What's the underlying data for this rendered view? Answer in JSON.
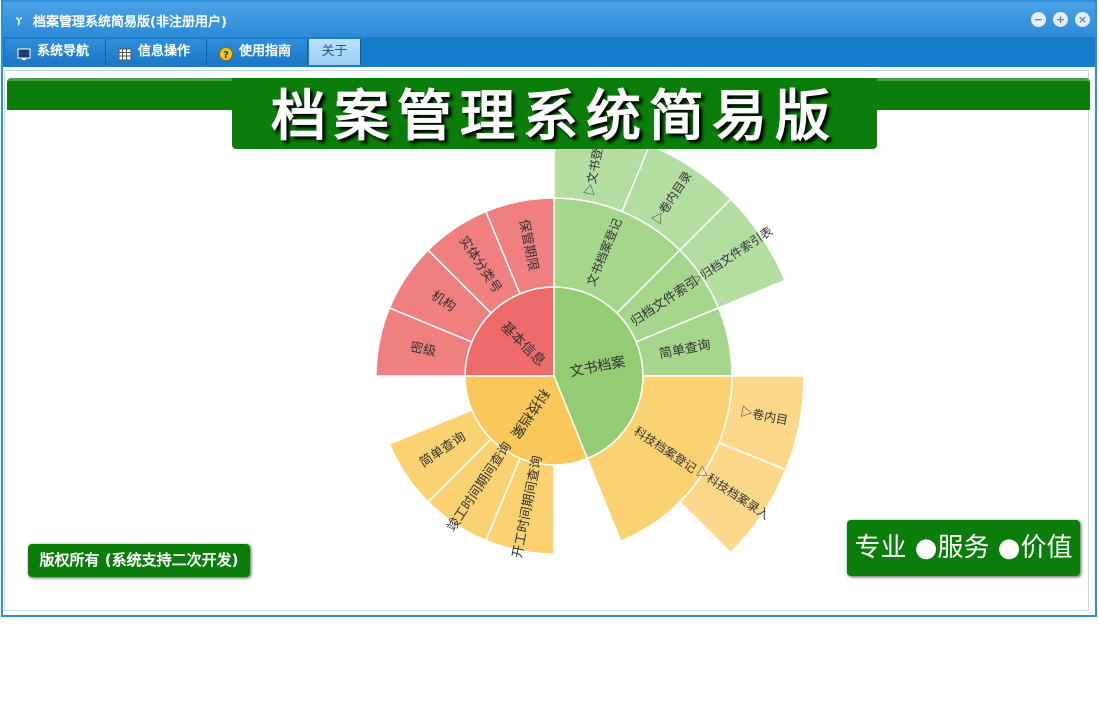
{
  "window": {
    "title": "档案管理系统简易版(非注册用户)",
    "app_icon": "yf-logo-icon"
  },
  "controls": {
    "minimize": "−",
    "restore": "+",
    "close": "×"
  },
  "menu": [
    {
      "label": "系统导航",
      "icon": "monitor-icon"
    },
    {
      "label": "信息操作",
      "icon": "grid-icon"
    },
    {
      "label": "使用指南",
      "icon": "help-icon"
    },
    {
      "label": "关于",
      "icon": ""
    }
  ],
  "banner": {
    "title": "档案管理系统简易版"
  },
  "footer": {
    "copyright": "版权所有 (系统支持二次开发)",
    "slogan": "专业 ●服务 ●价值"
  },
  "colors": {
    "red": "#ee6b6b",
    "red_light": "#f08080",
    "green": "#93cc72",
    "green_mid": "#a6d58c",
    "green_light": "#b4ddA2",
    "yellow": "#fac85a",
    "yellow_mid": "#fbd271",
    "yellow_light": "#fcd98a"
  },
  "sunburst": {
    "center_segments": [
      {
        "label": "基本信息"
      },
      {
        "label": "文书档案"
      },
      {
        "label": "科技档案"
      }
    ],
    "ring2": [
      {
        "label": "密级"
      },
      {
        "label": "机构"
      },
      {
        "label": "实体分类号"
      },
      {
        "label": "保管期限"
      },
      {
        "label": "文书档案登记"
      },
      {
        "label": "归档文件索引"
      },
      {
        "label": "简单查询"
      },
      {
        "label": "科技档案登记"
      },
      {
        "label": "开工时间期间查询"
      },
      {
        "label": "竣工时间期间查询"
      },
      {
        "label": "简单查询"
      }
    ],
    "ring3": [
      {
        "label": "▷文书登录"
      },
      {
        "label": "▷卷内目录"
      },
      {
        "label": "▷归档文件索引表"
      },
      {
        "label": "▷科技档案录入"
      },
      {
        "label": "▷卷内目"
      }
    ]
  }
}
